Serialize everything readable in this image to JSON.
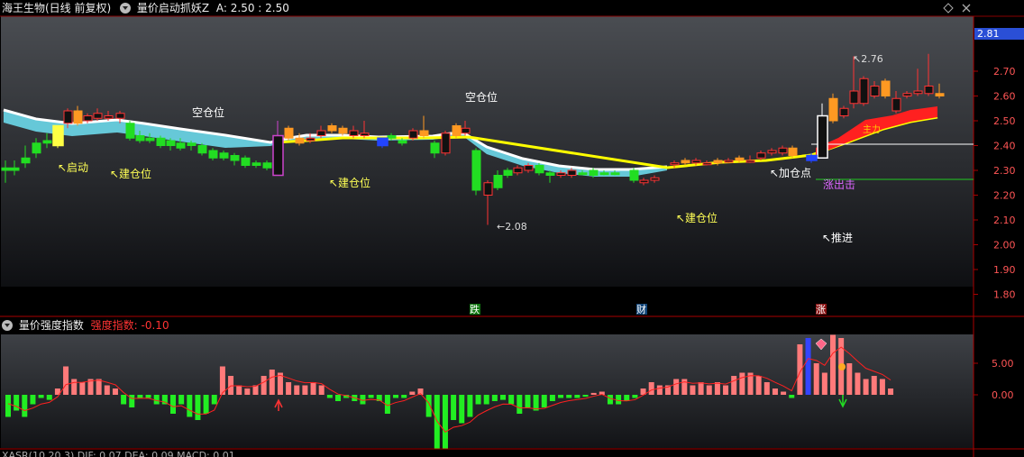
{
  "main_header": {
    "stock": "海王生物(日线 前复权)",
    "indicator": "量价启动抓妖Z",
    "values": "A: 2.50 : 2.50"
  },
  "main_chart": {
    "axis_ticks": [
      "2.70",
      "2.60",
      "2.50",
      "2.40",
      "2.30",
      "2.20",
      "2.10",
      "2.00",
      "1.90",
      "1.80"
    ],
    "current_price": "2.81",
    "price_high_label": "2.76",
    "price_low_label": "2.08",
    "annotations": {
      "qidong": "启动",
      "jiancang1": "建仓位",
      "kongcang1": "空仓位",
      "jiancang2": "建仓位",
      "kongcang2": "空仓位",
      "jiancang3": "建仓位",
      "jiacang": "加仓点",
      "tuijin": "推进",
      "zhangchuji": "涨出击",
      "zhuli": "主力"
    },
    "markers": {
      "die": "跌",
      "cai": "财",
      "zhang": "涨"
    },
    "colors": {
      "bull": "#ff3333",
      "bear": "#22dd22",
      "cloud": "#66c8d8",
      "band_red": "#ff2020",
      "band_yellow": "#ffff00"
    }
  },
  "sub_header": {
    "indicator": "量价强度指数",
    "label": "强度指数: -0.10"
  },
  "sub_chart": {
    "axis_ticks": [
      "5.00",
      "0.00"
    ]
  },
  "bottom_header": {
    "text": "XASR(10,20,3) DIF: 0.07 DEA: 0.09 MACD: 0.01"
  }
}
